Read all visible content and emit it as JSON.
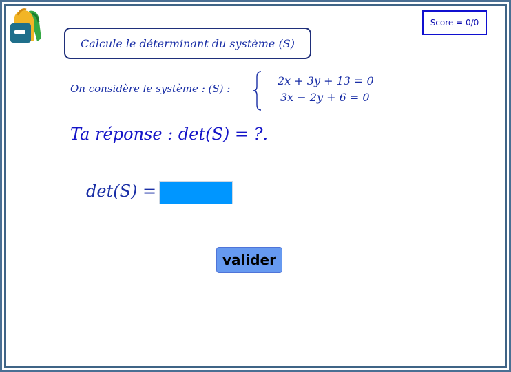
{
  "score": {
    "label": "Score = 0/0"
  },
  "instruction": "Calcule le déterminant du système (S)",
  "system": {
    "intro": "On considère le système : (S) :",
    "equation_1": "2x + 3y + 13 = 0",
    "equation_2": "3x − 2y + 6 = 0"
  },
  "answer_prompt": "Ta réponse : det(S) = ?.",
  "det_field": {
    "label": "det(S) =",
    "value": ""
  },
  "validate_button": {
    "label": "valider"
  },
  "colors": {
    "frame": "#4a6f93",
    "text_blue": "#1a2fa6",
    "input_fill": "#0096ff",
    "button_fill": "#6699f0"
  },
  "icons": {
    "logo": "backpack-icon"
  }
}
